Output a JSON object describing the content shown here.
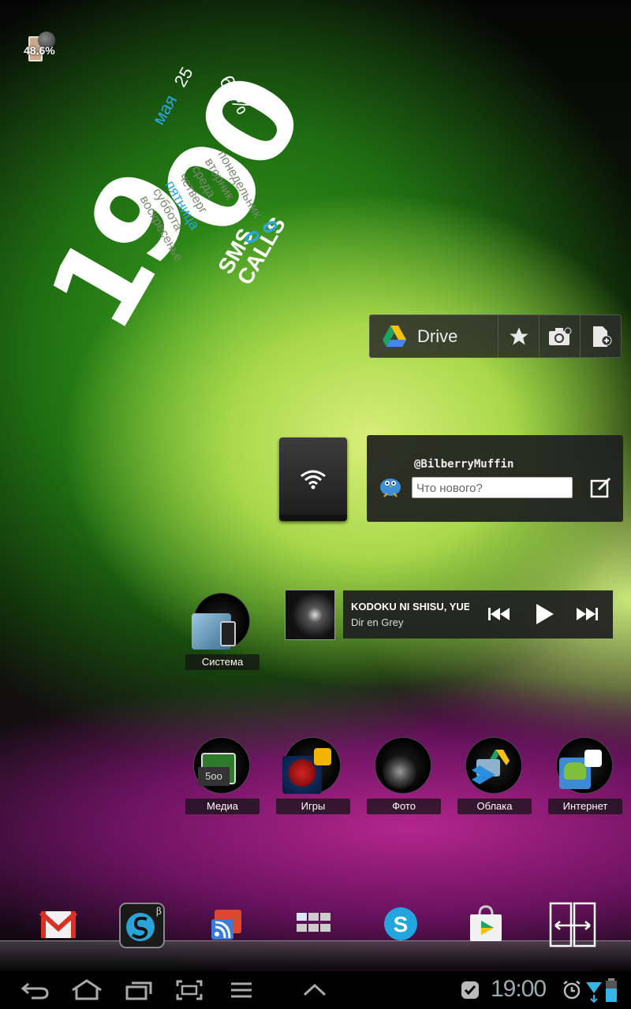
{
  "battery_widget": {
    "percent": "48.6%"
  },
  "clock_widget": {
    "time_hours": "19",
    "time_minutes": "00",
    "month": "мая",
    "day": "25",
    "battery": "69%",
    "weekdays": [
      "понедельник",
      "вторник",
      "среда",
      "четверг",
      "пятница",
      "суббота",
      "воскресенье"
    ],
    "today_index": 4,
    "sms_label": "SMS",
    "calls_label": "CALLS",
    "sms_count": "0",
    "calls_count": "0",
    "accent_color": "#2aa7e0"
  },
  "drive_widget": {
    "title": "Drive"
  },
  "twitter_widget": {
    "handle": "@BilberryMuffin",
    "placeholder": "Что нового?"
  },
  "music_widget": {
    "song": "KODOKU NI SHISU, YUE NI",
    "artist": "Dir en Grey"
  },
  "folders": [
    {
      "label": "Система"
    },
    {
      "label": "Медиа"
    },
    {
      "label": "Игры"
    },
    {
      "label": "Фото"
    },
    {
      "label": "Облака"
    },
    {
      "label": "Интернет"
    }
  ],
  "status_bar": {
    "time": "19:00"
  }
}
